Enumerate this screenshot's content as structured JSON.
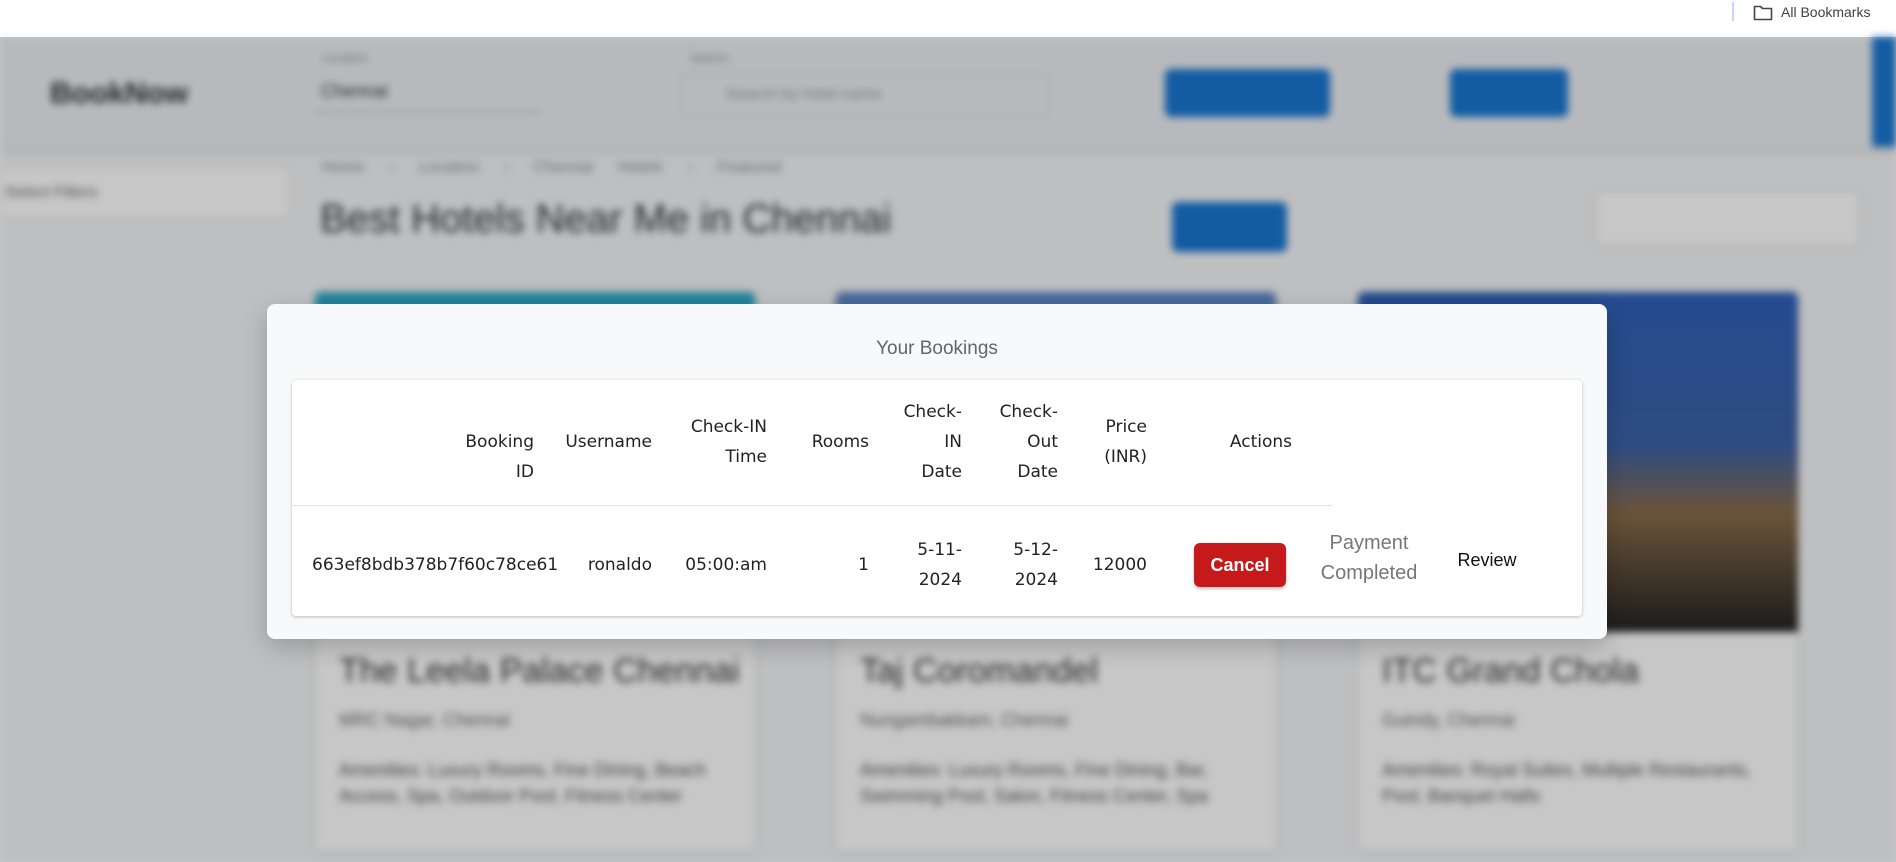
{
  "browser": {
    "bookmarks_label": "All Bookmarks"
  },
  "background": {
    "logo": "BookNow",
    "location_label": "Location",
    "location_value": "Chennai",
    "search_label": "Search",
    "search_placeholder": "Search by hotel name",
    "sidebar_select": "Select Filters",
    "breadcrumbs": "Home › Location › Chennai Hotels › Featured",
    "page_title": "Best Hotels Near Me in Chennai",
    "cards": [
      {
        "title": "The Leela Palace Chennai",
        "area": "MRC Nagar, Chennai",
        "desc": "Amenities: Luxury Rooms, Fine Dining, Beach Access, Spa, Outdoor Pool, Fitness Center"
      },
      {
        "title": "Taj Coromandel",
        "area": "Nungambakkam, Chennai",
        "desc": "Amenities: Luxury Rooms, Fine Dining, Bar, Swimming Pool, Salon, Fitness Center, Spa"
      },
      {
        "title": "ITC Grand Chola",
        "area": "Guindy, Chennai",
        "desc": "Amenities: Royal Suites, Multiple Restaurants, Pool, Banquet Halls"
      }
    ]
  },
  "modal": {
    "title": "Your Bookings",
    "headers": {
      "booking_id": "Booking ID",
      "username": "Username",
      "checkin_time_1": "Check-IN",
      "checkin_time_2": "Time",
      "rooms": "Rooms",
      "checkin_date_1": "Check-",
      "checkin_date_2": "IN",
      "checkin_date_3": "Date",
      "checkout_date_1": "Check-",
      "checkout_date_2": "Out",
      "checkout_date_3": "Date",
      "price_1": "Price",
      "price_2": "(INR)",
      "actions": "Actions"
    },
    "rows": [
      {
        "booking_id": "663ef8bdb378b7f60c78ce61",
        "username": "ronaldo",
        "checkin_time": "05:00:am",
        "rooms": "1",
        "checkin_date_1": "5-11-",
        "checkin_date_2": "2024",
        "checkout_date_1": "5-12-",
        "checkout_date_2": "2024",
        "price": "12000",
        "cancel_label": "Cancel",
        "status_1": "Payment",
        "status_2": "Completed",
        "review_label": "Review"
      }
    ]
  }
}
